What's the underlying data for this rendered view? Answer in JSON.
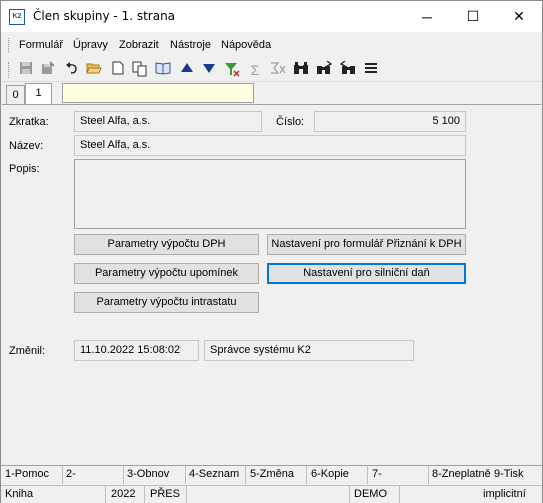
{
  "window": {
    "icon_text": "K2",
    "title": "Člen skupiny - 1. strana",
    "minimize": "─",
    "maximize": "☐",
    "close": "✕"
  },
  "menu": {
    "items": [
      "Formulář",
      "Úpravy",
      "Zobrazit",
      "Nástroje",
      "Nápověda"
    ]
  },
  "toolbar": {
    "icons": [
      "save-icon",
      "save-as-icon",
      "undo-icon",
      "open-folder-icon",
      "new-icon",
      "copy-icon",
      "book-icon",
      "arrow-up-icon",
      "arrow-down-icon",
      "filter-icon",
      "sum-icon",
      "formula-icon",
      "binoculars-icon",
      "binoculars-next-icon",
      "menu-icon"
    ]
  },
  "tabs": {
    "items": [
      "0",
      "1"
    ],
    "active": "1"
  },
  "form": {
    "zkratka_label": "Zkratka:",
    "zkratka_value": "Steel Alfa, a.s.",
    "cislo_label": "Číslo:",
    "cislo_value": "5 100",
    "nazev_label": "Název:",
    "nazev_value": "Steel Alfa, a.s.",
    "popis_label": "Popis:",
    "popis_value": "",
    "zmenil_label": "Změnil:",
    "zmenil_date": "11.10.2022 15:08:02",
    "zmenil_user": "Správce systému K2"
  },
  "buttons": {
    "dph": "Parametry výpočtu DPH",
    "priznani": "Nastavení pro formulář Přiznání k DPH",
    "upominky": "Parametry výpočtu upomínek",
    "silnicni": "Nastavení pro silniční daň",
    "intrastat": "Parametry výpočtu intrastatu"
  },
  "fkeys": [
    "1-Pomoc",
    "2-",
    "3-Obnov",
    "4-Seznam",
    "5-Změna",
    "6-Kopie",
    "7-",
    "8-Zneplatně",
    "9-Tisk"
  ],
  "status": {
    "book": "Kniha",
    "year": "2022",
    "mode": "PŘES",
    "db": "DEMO",
    "implicit": "implicitní"
  }
}
